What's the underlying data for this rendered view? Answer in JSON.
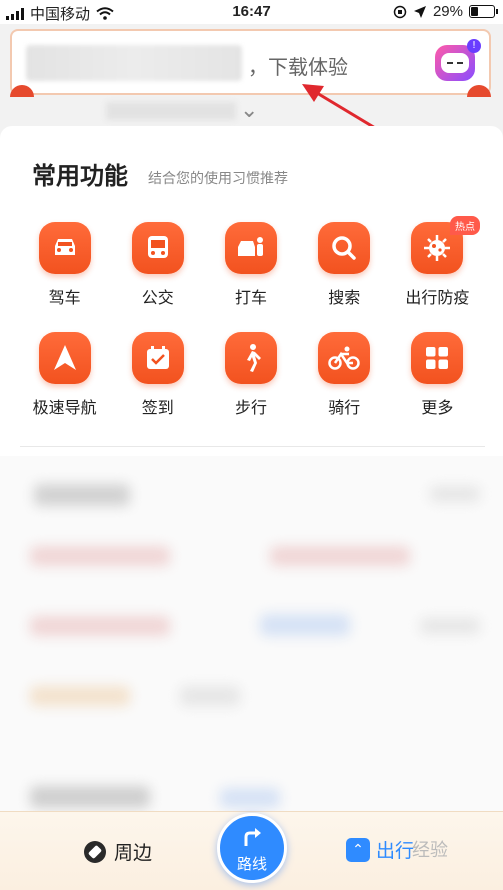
{
  "status_bar": {
    "carrier": "中国移动",
    "time": "16:47",
    "battery": "29%",
    "battery_level": 0.29
  },
  "banner": {
    "text": "，下载体验",
    "badge": "!"
  },
  "common": {
    "title": "常用功能",
    "subtitle": "结合您的使用习惯推荐",
    "items": [
      {
        "label": "驾车",
        "icon": "car-icon"
      },
      {
        "label": "公交",
        "icon": "bus-icon"
      },
      {
        "label": "打车",
        "icon": "taxi-icon"
      },
      {
        "label": "搜索",
        "icon": "search-icon"
      },
      {
        "label": "出行防疫",
        "icon": "virus-icon",
        "badge": "热点"
      },
      {
        "label": "极速导航",
        "icon": "navigation-arrow-icon"
      },
      {
        "label": "签到",
        "icon": "calendar-check-icon"
      },
      {
        "label": "步行",
        "icon": "walk-icon"
      },
      {
        "label": "骑行",
        "icon": "bike-icon"
      },
      {
        "label": "更多",
        "icon": "grid-icon"
      }
    ]
  },
  "bottom_nav": {
    "nearby": "周边",
    "route": "路线",
    "travel": "出行",
    "watermark": "经验"
  },
  "colors": {
    "accent": "#f2521f",
    "route_blue": "#2f8bff",
    "annotation_red": "#e0282e"
  }
}
